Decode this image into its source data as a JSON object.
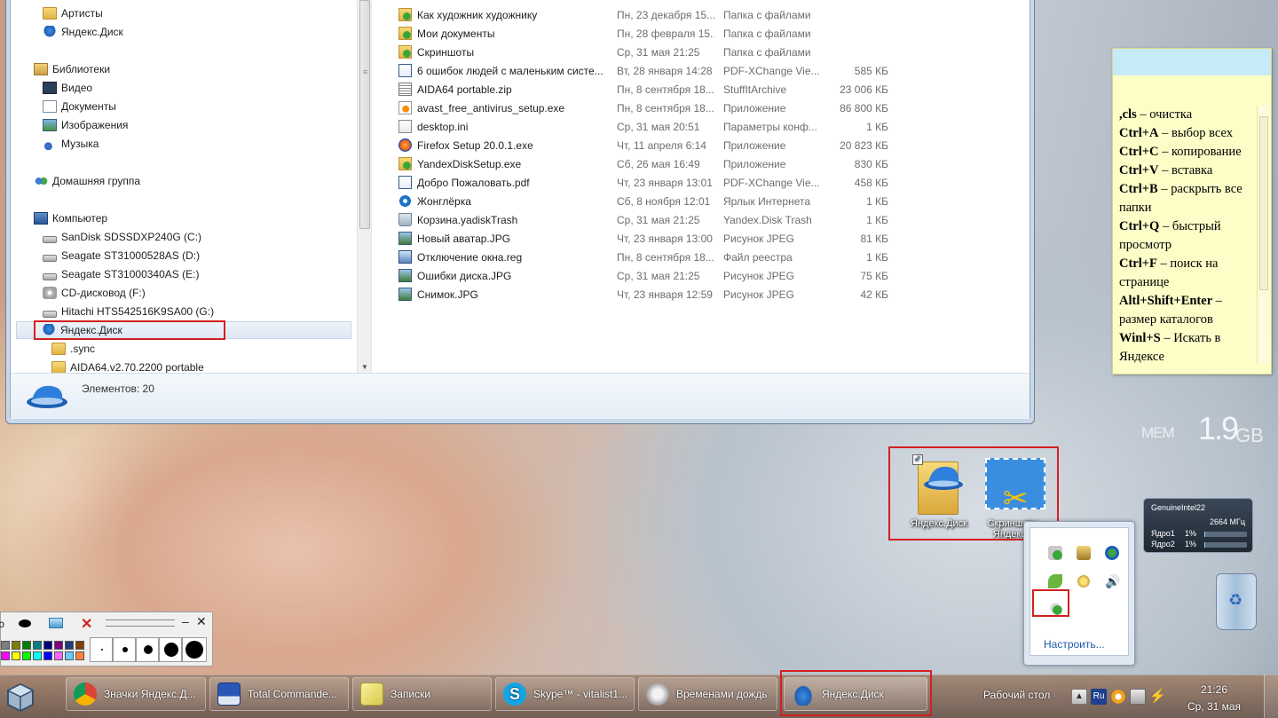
{
  "explorer": {
    "nav_items": [
      {
        "label": "Артисты",
        "icon": "folder-icon"
      },
      {
        "label": "Яндекс.Диск",
        "icon": "yandex-disk-icon"
      },
      {
        "label": "Библиотеки",
        "icon": "libraries-icon"
      },
      {
        "label": "Видео",
        "icon": "video-library-icon"
      },
      {
        "label": "Документы",
        "icon": "documents-library-icon"
      },
      {
        "label": "Изображения",
        "icon": "pictures-library-icon"
      },
      {
        "label": "Музыка",
        "icon": "music-library-icon"
      },
      {
        "label": "Домашняя группа",
        "icon": "homegroup-icon"
      },
      {
        "label": "Компьютер",
        "icon": "computer-icon"
      },
      {
        "label": "SanDisk SDSSDXP240G (C:)",
        "icon": "drive-icon"
      },
      {
        "label": "Seagate ST31000528AS (D:)",
        "icon": "drive-icon"
      },
      {
        "label": "Seagate ST31000340AS (E:)",
        "icon": "drive-icon"
      },
      {
        "label": "CD-дисковод (F:)",
        "icon": "cd-drive-icon"
      },
      {
        "label": "Hitachi HTS542516K9SA00 (G:)",
        "icon": "drive-icon"
      },
      {
        "label": "Яндекс.Диск",
        "icon": "yandex-disk-icon"
      },
      {
        "label": ".sync",
        "icon": "folder-icon"
      },
      {
        "label": "AIDA64.v2.70.2200 portable",
        "icon": "folder-icon"
      }
    ],
    "files": [
      {
        "name": "Как художник художнику",
        "date": "Пн, 23 декабря 15...",
        "type": "Папка с файлами",
        "size": "",
        "icon": "synced-folder-icon"
      },
      {
        "name": "Мои документы",
        "date": "Пн, 28 февраля 15...",
        "type": "Папка с файлами",
        "size": "",
        "icon": "synced-folder-icon"
      },
      {
        "name": "Скриншоты",
        "date": "Ср, 31 мая 21:25",
        "type": "Папка с файлами",
        "size": "",
        "icon": "synced-folder-icon"
      },
      {
        "name": "6 ошибок людей с маленьким систе...",
        "date": "Вт, 28 января 14:28",
        "type": "PDF-XChange Vie...",
        "size": "585 КБ",
        "icon": "pdf-icon"
      },
      {
        "name": "AIDA64 portable.zip",
        "date": "Пн, 8 сентября 18...",
        "type": "StuffItArchive",
        "size": "23 006 КБ",
        "icon": "zip-icon"
      },
      {
        "name": "avast_free_antivirus_setup.exe",
        "date": "Пн, 8 сентября 18...",
        "type": "Приложение",
        "size": "86 800 КБ",
        "icon": "avast-icon"
      },
      {
        "name": "desktop.ini",
        "date": "Ср, 31 мая 20:51",
        "type": "Параметры конф...",
        "size": "1 КБ",
        "icon": "ini-icon"
      },
      {
        "name": "Firefox Setup 20.0.1.exe",
        "date": "Чт, 11 апреля 6:14",
        "type": "Приложение",
        "size": "20 823 КБ",
        "icon": "firefox-icon"
      },
      {
        "name": "YandexDiskSetup.exe",
        "date": "Сб, 26 мая 16:49",
        "type": "Приложение",
        "size": "830 КБ",
        "icon": "yandex-disk-setup-icon"
      },
      {
        "name": "Добро Пожаловать.pdf",
        "date": "Чт, 23 января 13:01",
        "type": "PDF-XChange Vie...",
        "size": "458 КБ",
        "icon": "pdf-icon"
      },
      {
        "name": "Жонглёрка",
        "date": "Сб, 8 ноября 12:01",
        "type": "Ярлык Интернета",
        "size": "1 КБ",
        "icon": "internet-shortcut-icon"
      },
      {
        "name": "Корзина.yadiskTrash",
        "date": "Ср, 31 мая 21:25",
        "type": "Yandex.Disk Trash",
        "size": "1 КБ",
        "icon": "trash-icon"
      },
      {
        "name": "Новый аватар.JPG",
        "date": "Чт, 23 января 13:00",
        "type": "Рисунок JPEG",
        "size": "81 КБ",
        "icon": "jpeg-icon"
      },
      {
        "name": "Отключение окна.reg",
        "date": "Пн, 8 сентября 18...",
        "type": "Файл реестра",
        "size": "1 КБ",
        "icon": "registry-icon"
      },
      {
        "name": "Ошибки диска.JPG",
        "date": "Ср, 31 мая 21:25",
        "type": "Рисунок JPEG",
        "size": "75 КБ",
        "icon": "jpeg-icon"
      },
      {
        "name": "Снимок.JPG",
        "date": "Чт, 23 января 12:59",
        "type": "Рисунок JPEG",
        "size": "42 КБ",
        "icon": "jpeg-icon"
      }
    ],
    "status": "Элементов: 20"
  },
  "sticky": {
    "lines": [
      {
        "key": ",cls",
        "text": " – очистка"
      },
      {
        "key": "Ctrl+A",
        "text": " – выбор всех"
      },
      {
        "key": "Ctrl+C",
        "text": " – копирование"
      },
      {
        "key": "Ctrl+V",
        "text": " – вставка"
      },
      {
        "key": "Ctrl+B",
        "text": " – раскрыть все папки"
      },
      {
        "key": "Ctrl+Q",
        "text": " – быстрый просмотр"
      },
      {
        "key": "Ctrl+F",
        "text": " – поиск на странице"
      },
      {
        "key": "Altl+Shift+Enter",
        "text": " – размер каталогов"
      },
      {
        "key": "Winl+S",
        "text": " – Искать в Яндексе"
      }
    ]
  },
  "mem_gadget": {
    "label": "MEM",
    "value": "1.9",
    "unit": "GB"
  },
  "cpu_gadget": {
    "name": "GenuineIntel22",
    "freq": "2664 МГц",
    "cores": [
      {
        "label": "Ядро1",
        "value": "1%",
        "load": 0.01
      },
      {
        "label": "Ядро2",
        "value": "1%",
        "load": 0.01
      }
    ]
  },
  "desktop_icons": [
    {
      "label": "Яндекс.Диск",
      "icon": "yandex-disk-folder-icon",
      "checked": true
    },
    {
      "label": "Скриншоты Яндекс...",
      "icon": "screenshot-scissors-icon"
    }
  ],
  "tray_popup": {
    "icons": [
      "yandex-disk-sync-icon",
      "network-tool-icon",
      "globe-network-icon",
      "green-leaf-icon",
      "gear-small-icon",
      "volume-icon",
      "yandex-disk-tray-icon"
    ],
    "customize": "Настроить..."
  },
  "taskbar": {
    "buttons": [
      {
        "label": "Значки Яндекс.Д...",
        "icon": "chrome-icon"
      },
      {
        "label": "Total Commande...",
        "icon": "floppy-icon"
      },
      {
        "label": "Записки",
        "icon": "notes-icon"
      },
      {
        "label": "Skype™ - vitalist1...",
        "icon": "skype-icon"
      },
      {
        "label": "Временами дождь",
        "icon": "weather-icon"
      },
      {
        "label": "Яндекс.Диск",
        "icon": "yandex-disk-icon"
      }
    ],
    "desktop_label": "Рабочий стол",
    "lang": "Ru",
    "time": "21:26",
    "date": "Ср, 31 мая"
  },
  "colors": {
    "highlight": "#d3201f",
    "yandex_blue": "#1d5fb4",
    "sticky_bg": "#fdfdc8"
  }
}
